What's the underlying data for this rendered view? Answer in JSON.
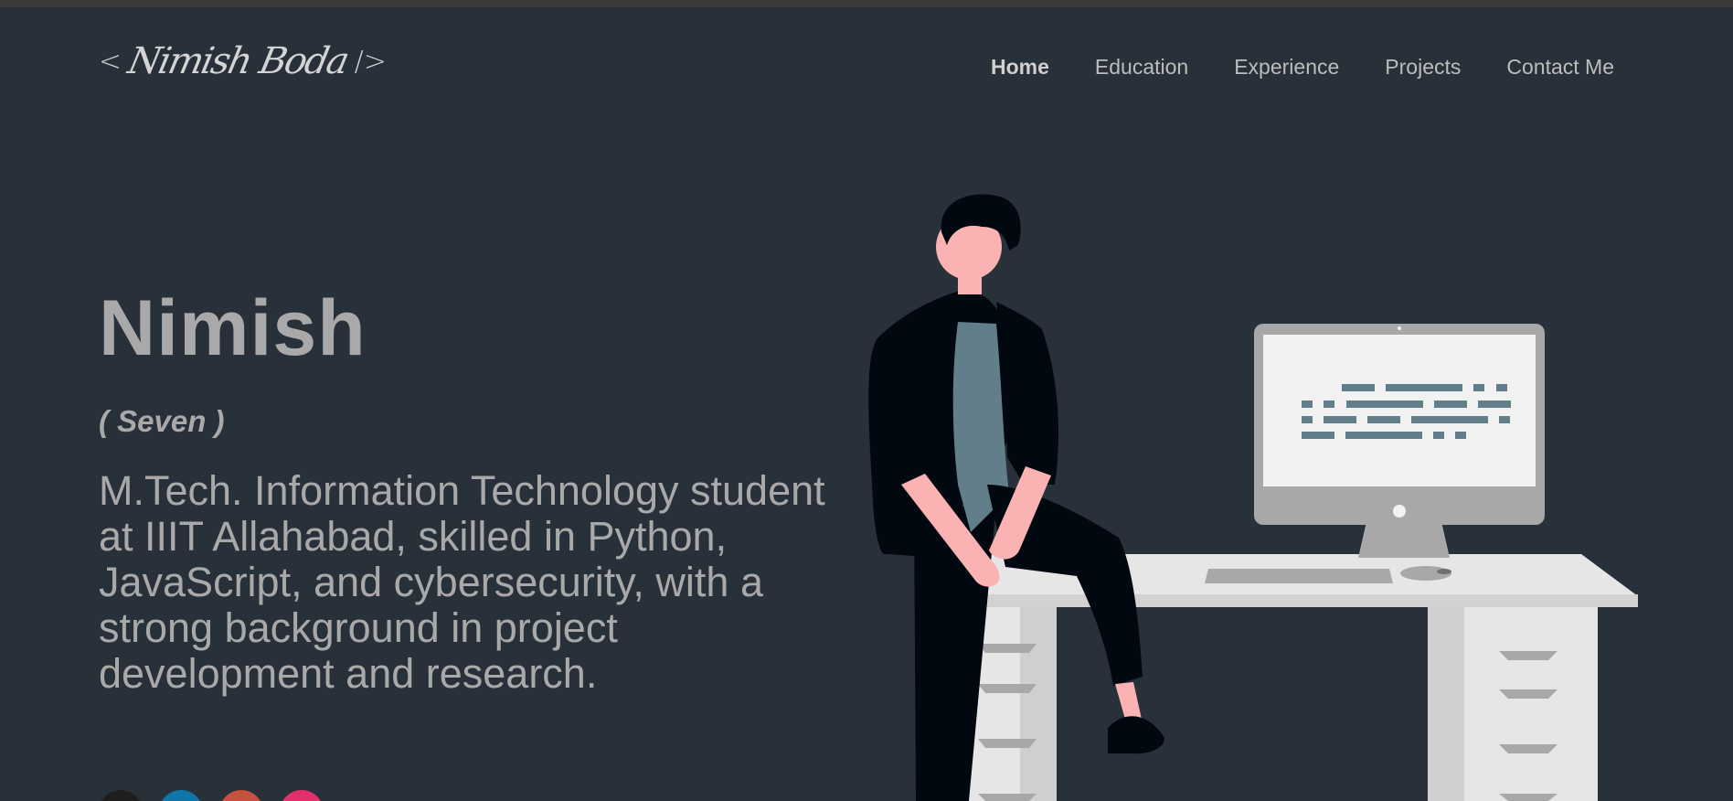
{
  "logo": {
    "open": "<",
    "signature": "Nimish Boda",
    "close": "/>"
  },
  "nav": {
    "items": [
      {
        "label": "Home",
        "active": true
      },
      {
        "label": "Education"
      },
      {
        "label": "Experience"
      },
      {
        "label": "Projects"
      },
      {
        "label": "Contact Me"
      }
    ]
  },
  "hero": {
    "name": "Nimish",
    "nickname": "( Seven )",
    "description": "M.Tech. Information Technology student at IIIT Allahabad, skilled in Python, JavaScript, and cybersecurity, with a strong background in project development and research."
  },
  "socials": [
    {
      "icon": "github-icon",
      "color": "#1e1e1e"
    },
    {
      "icon": "linkedin-icon",
      "color": "#0e76a8"
    },
    {
      "icon": "gmail-icon",
      "color": "#c6513f"
    },
    {
      "icon": "instagram-icon",
      "color": "#e1306c"
    }
  ],
  "colors": {
    "background": "#28313a",
    "text": "#a9a9a9",
    "shirt": "#627e8a",
    "skin": "#fbb2b2",
    "desk": "#e6e6e6"
  }
}
